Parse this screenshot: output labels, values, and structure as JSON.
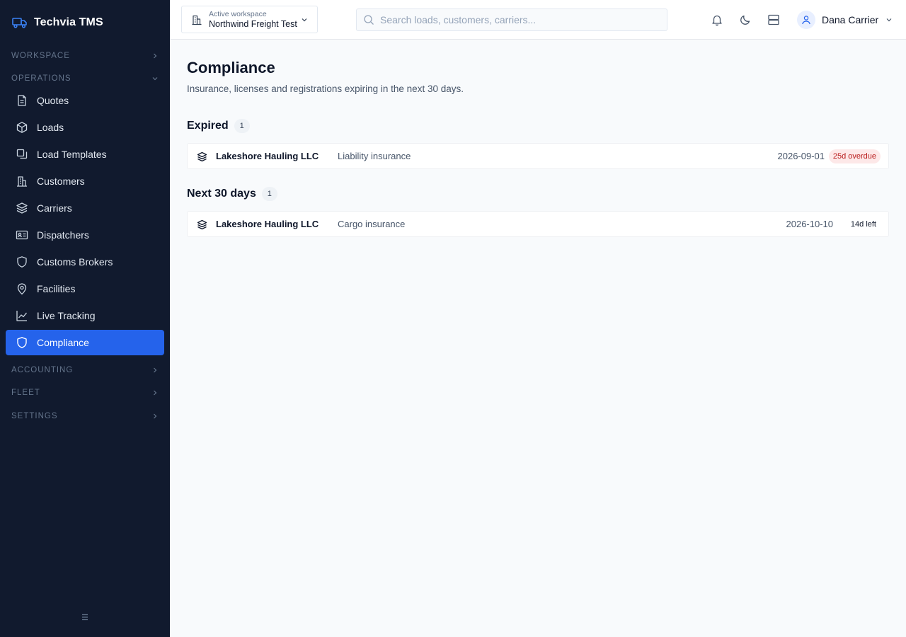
{
  "app": {
    "name": "Techvia TMS"
  },
  "sidebar": {
    "sections": {
      "workspace": "WORKSPACE",
      "operations": "OPERATIONS",
      "accounting": "ACCOUNTING",
      "fleet": "FLEET",
      "settings": "SETTINGS"
    },
    "items": [
      {
        "label": "Quotes",
        "icon": "file-text-icon"
      },
      {
        "label": "Loads",
        "icon": "box-icon"
      },
      {
        "label": "Load Templates",
        "icon": "copy-icon"
      },
      {
        "label": "Customers",
        "icon": "building-icon"
      },
      {
        "label": "Carriers",
        "icon": "layers-icon"
      },
      {
        "label": "Dispatchers",
        "icon": "id-card-icon"
      },
      {
        "label": "Customs Brokers",
        "icon": "shield-icon"
      },
      {
        "label": "Facilities",
        "icon": "map-pin-icon"
      },
      {
        "label": "Live Tracking",
        "icon": "line-chart-icon"
      },
      {
        "label": "Compliance",
        "icon": "shield-icon",
        "active": true
      }
    ]
  },
  "topbar": {
    "workspace_label": "Active workspace",
    "workspace_value": "Northwind Freight Test",
    "search_placeholder": "Search loads, customers, carriers...",
    "user_name": "Dana Carrier"
  },
  "page": {
    "title": "Compliance",
    "subtitle": "Insurance, licenses and registrations expiring in the next 30 days."
  },
  "groups": {
    "expired": {
      "title": "Expired",
      "count": "1",
      "rows": [
        {
          "name": "Lakeshore Hauling LLC",
          "type": "Liability insurance",
          "date": "2026-09-01",
          "badge": "25d overdue"
        }
      ]
    },
    "next30": {
      "title": "Next 30 days",
      "count": "1",
      "rows": [
        {
          "name": "Lakeshore Hauling LLC",
          "type": "Cargo insurance",
          "date": "2026-10-10",
          "badge": "14d left"
        }
      ]
    }
  },
  "colors": {
    "sidebar_bg": "#111a2e",
    "accent": "#2563eb",
    "overdue_bg": "#fde8e8",
    "overdue_text": "#b91c1c"
  }
}
